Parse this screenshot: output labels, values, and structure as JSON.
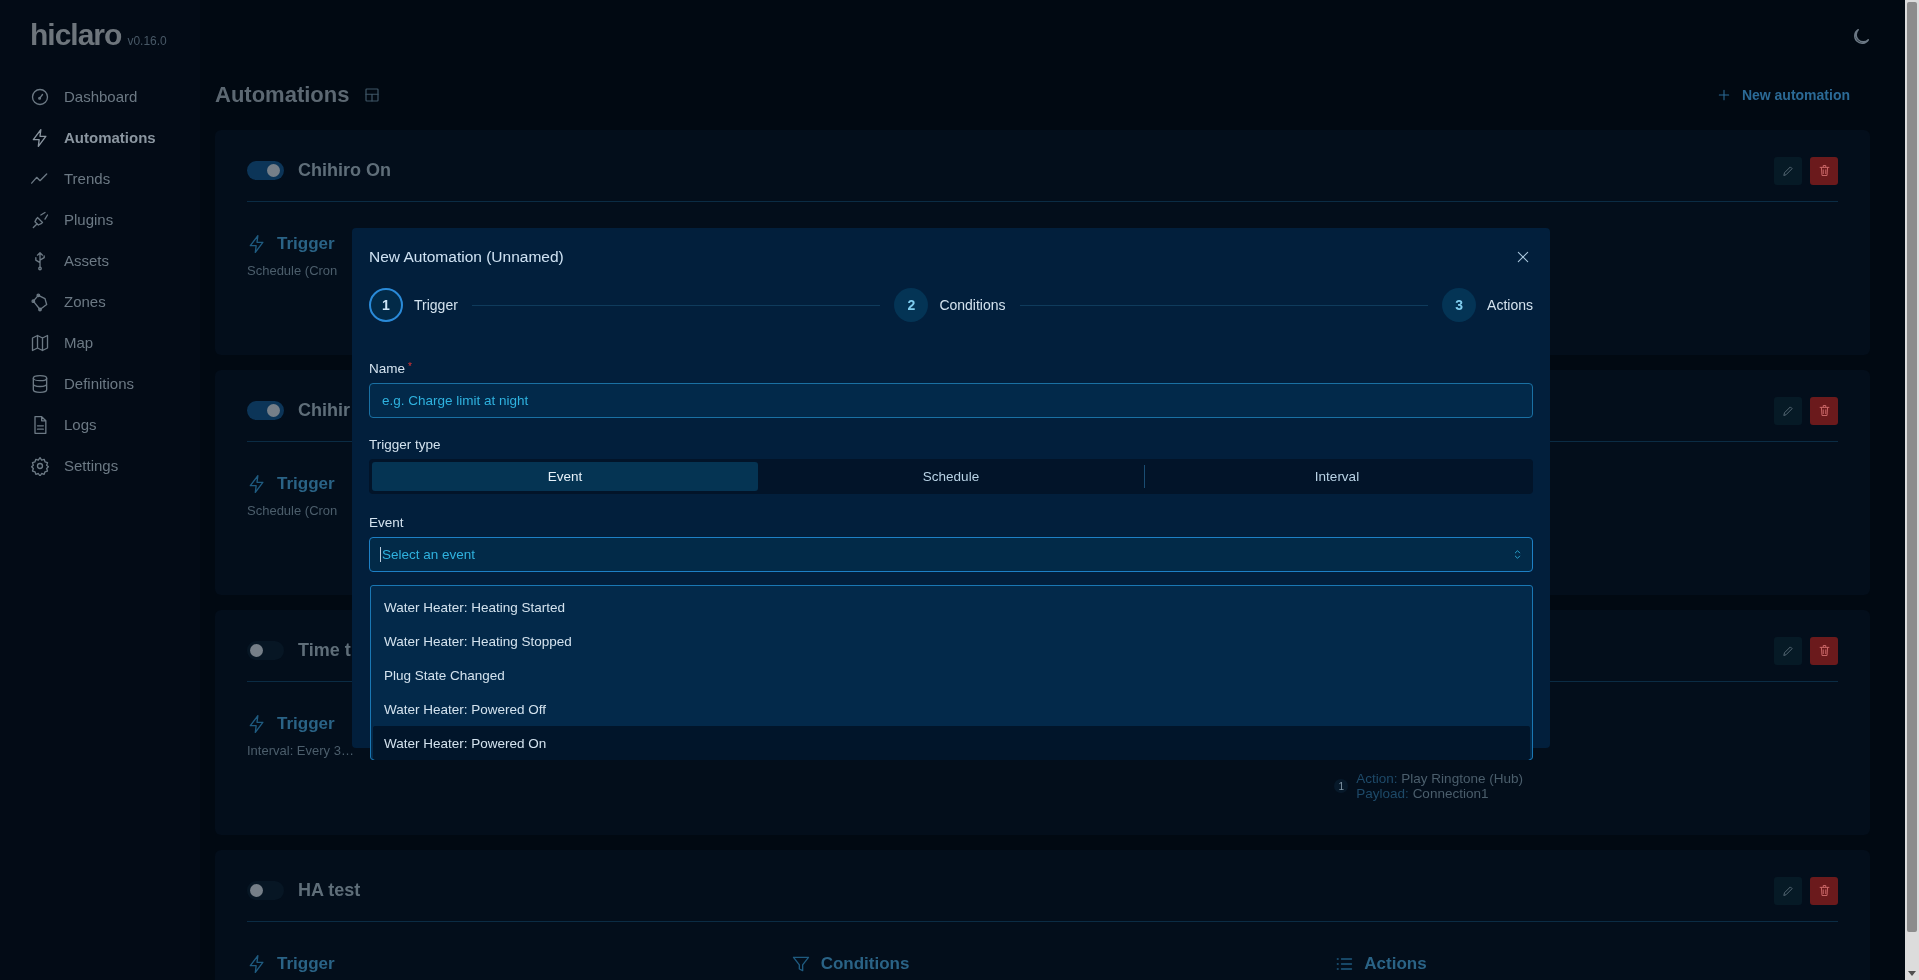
{
  "app": {
    "name": "hiclaro",
    "version": "v0.16.0"
  },
  "sidebar": {
    "items": [
      {
        "label": "Dashboard",
        "selected": false
      },
      {
        "label": "Automations",
        "selected": true
      },
      {
        "label": "Trends",
        "selected": false
      },
      {
        "label": "Plugins",
        "selected": false
      },
      {
        "label": "Assets",
        "selected": false
      },
      {
        "label": "Zones",
        "selected": false
      },
      {
        "label": "Map",
        "selected": false
      },
      {
        "label": "Definitions",
        "selected": false
      },
      {
        "label": "Logs",
        "selected": false
      },
      {
        "label": "Settings",
        "selected": false
      }
    ]
  },
  "page": {
    "title": "Automations",
    "new_button": "New automation"
  },
  "automations": [
    {
      "name": "Chihiro On",
      "enabled": true,
      "trigger": {
        "label": "Trigger",
        "summary": "Schedule (Cron"
      }
    },
    {
      "name": "Chihir",
      "enabled": true,
      "trigger": {
        "label": "Trigger",
        "summary": "Schedule (Cron"
      }
    },
    {
      "name": "Time t",
      "enabled": false,
      "trigger": {
        "label": "Trigger",
        "summary": "Interval: Every 3…"
      },
      "actions": {
        "items": [
          {
            "number": "1",
            "action_label": "Action:",
            "action": "Play Ringtone (Hub)",
            "payload_label": "Payload:",
            "payload": "Connection1"
          }
        ]
      }
    },
    {
      "name": "HA test",
      "enabled": false,
      "trigger": {
        "label": "Trigger"
      },
      "conditions": {
        "label": "Conditions"
      },
      "actions": {
        "label": "Actions"
      }
    }
  ],
  "modal": {
    "title": "New Automation (Unnamed)",
    "steps": [
      {
        "number": "1",
        "label": "Trigger",
        "selected": true
      },
      {
        "number": "2",
        "label": "Conditions",
        "selected": false
      },
      {
        "number": "3",
        "label": "Actions",
        "selected": false
      }
    ],
    "name_field": {
      "label": "Name",
      "required_mark": "*",
      "placeholder": "e.g. Charge limit at night"
    },
    "trigger_type": {
      "label": "Trigger type",
      "options": [
        {
          "label": "Event",
          "selected": true
        },
        {
          "label": "Schedule",
          "selected": false
        },
        {
          "label": "Interval",
          "selected": false
        }
      ]
    },
    "event": {
      "label": "Event",
      "placeholder": "Select an event",
      "options": [
        {
          "label": "Water Heater: Heating Started",
          "highlighted": false
        },
        {
          "label": "Water Heater: Heating Stopped",
          "highlighted": false
        },
        {
          "label": "Plug State Changed",
          "highlighted": false
        },
        {
          "label": "Water Heater: Powered Off",
          "highlighted": false
        },
        {
          "label": "Water Heater: Powered On",
          "highlighted": true
        }
      ]
    }
  }
}
